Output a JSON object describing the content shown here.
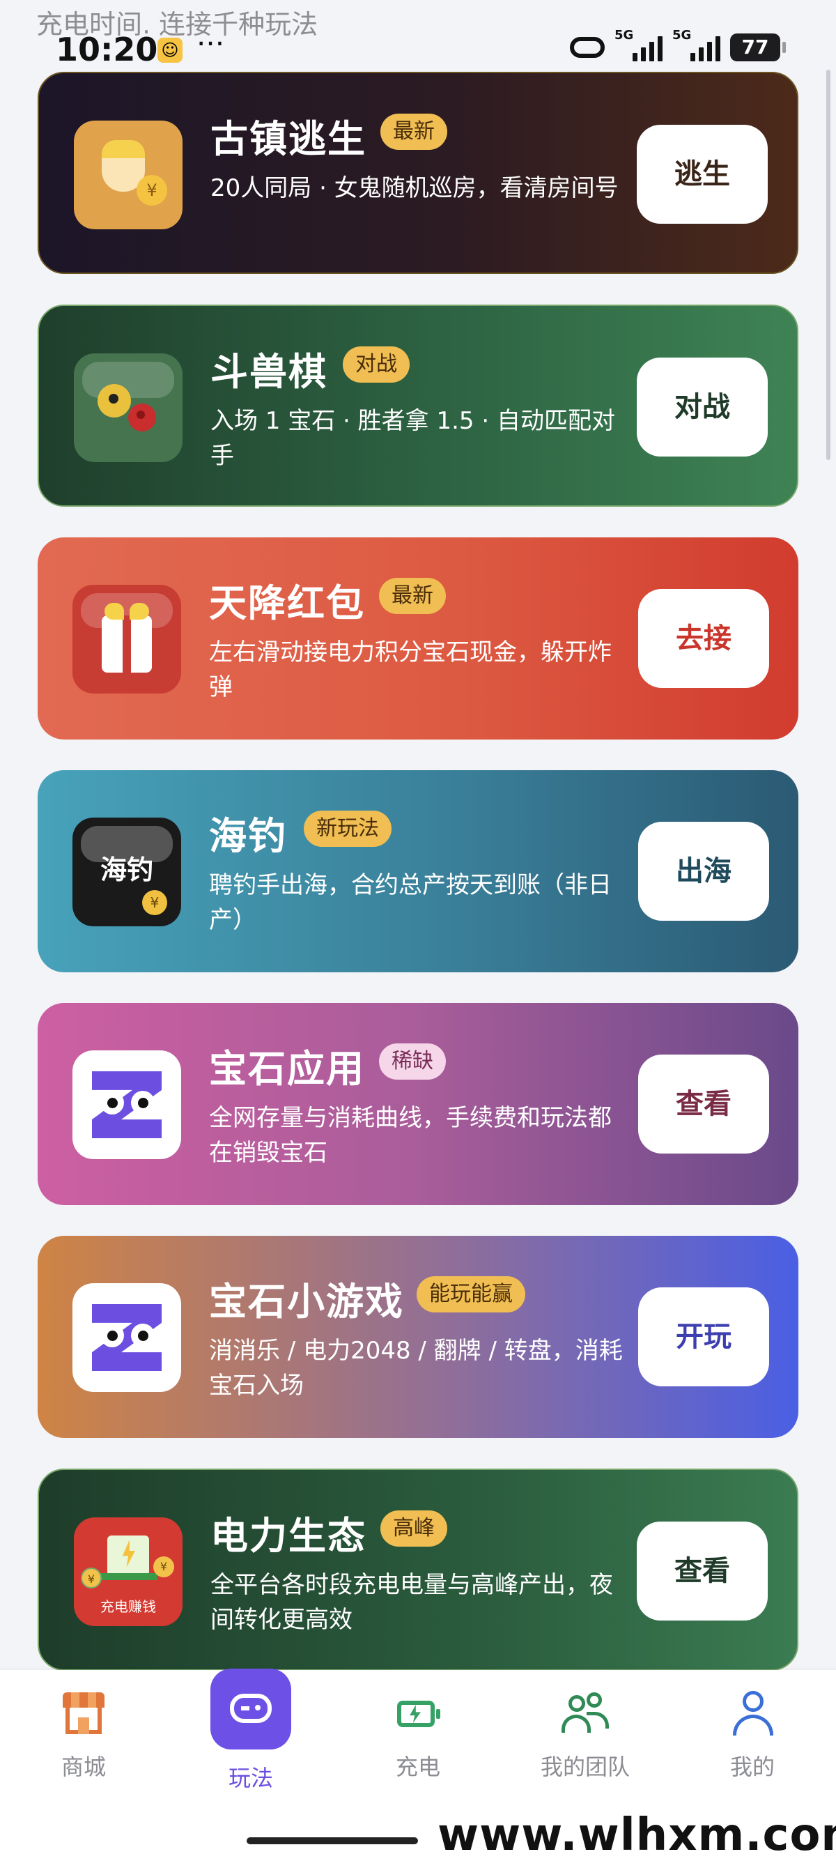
{
  "status_bar": {
    "slogan": "充电时间. 连接千种玩法",
    "time": "10:20",
    "more": "···",
    "signal1_label": "5G",
    "signal2_label": "5G",
    "battery": "77"
  },
  "cards": [
    {
      "title": "古镇逃生",
      "badge": "最新",
      "desc": "20人同局 · 女鬼随机巡房，看清房间号",
      "button": "逃生",
      "button_color": "#3a2418"
    },
    {
      "title": "斗兽棋",
      "badge": "对战",
      "desc": "入场 1 宝石 · 胜者拿 1.5 · 自动匹配对手",
      "button": "对战",
      "button_color": "#1f3a28"
    },
    {
      "title": "天降红包",
      "badge": "最新",
      "desc": "左右滑动接电力积分宝石现金，躲开炸弹",
      "button": "去接",
      "button_color": "#c9352b"
    },
    {
      "title": "海钓",
      "badge": "新玩法",
      "icon_text": "海钓",
      "desc": "聘钓手出海，合约总产按天到账（非日产）",
      "button": "出海",
      "button_color": "#1f4a5c"
    },
    {
      "title": "宝石应用",
      "badge": "稀缺",
      "desc": "全网存量与消耗曲线，手续费和玩法都在销毁宝石",
      "button": "查看",
      "button_color": "#7a2c45"
    },
    {
      "title": "宝石小游戏",
      "badge": "能玩能赢",
      "desc": "消消乐 / 电力2048 / 翻牌 / 转盘，消耗宝石入场",
      "button": "开玩",
      "button_color": "#3d3fb0"
    },
    {
      "title": "电力生态",
      "badge": "高峰",
      "icon_text": "充电赚钱",
      "desc": "全平台各时段充电电量与高峰产出，夜间转化更高效",
      "button": "查看",
      "button_color": "#1f3a28"
    }
  ],
  "tabs": [
    {
      "label": "商城",
      "icon": "shop-icon"
    },
    {
      "label": "玩法",
      "icon": "gamepad-icon",
      "active": true
    },
    {
      "label": "充电",
      "icon": "battery-charge-icon"
    },
    {
      "label": "我的团队",
      "icon": "team-icon"
    },
    {
      "label": "我的",
      "icon": "user-icon"
    }
  ],
  "watermark": "www.wlhxm.com",
  "colors": {
    "accent": "#6d50e6",
    "badge": "#f0be52",
    "background": "#f3f4f8"
  }
}
